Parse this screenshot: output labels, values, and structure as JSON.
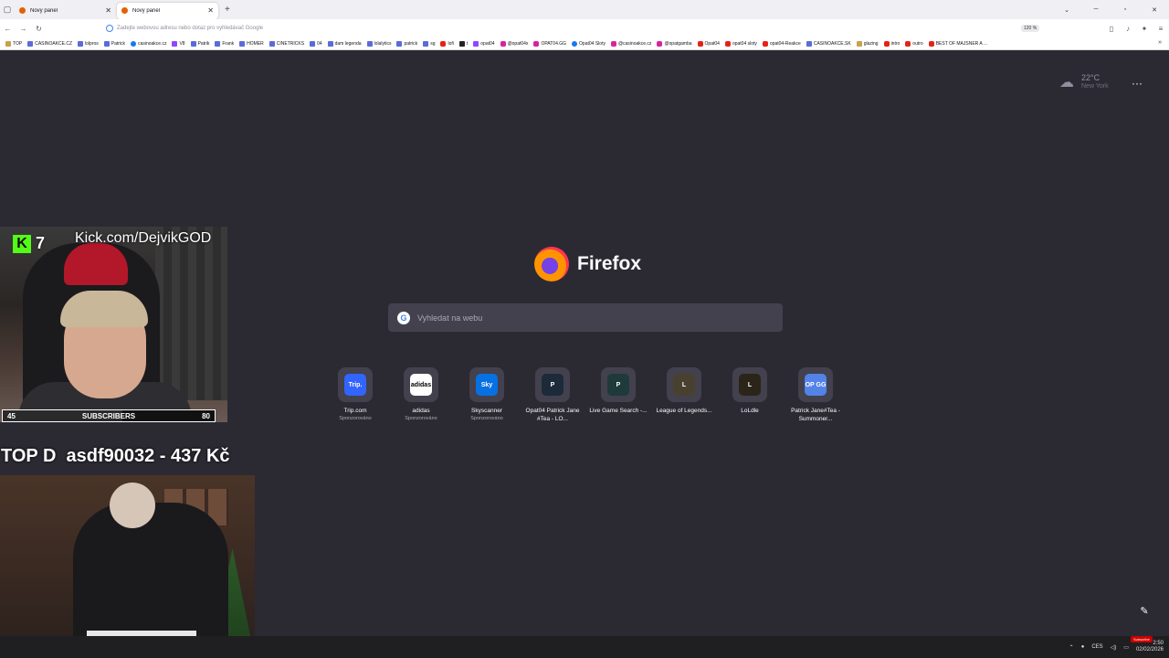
{
  "browser": {
    "tabs": [
      {
        "title": "Nový panel",
        "active": false
      },
      {
        "title": "Nový panel",
        "active": true
      }
    ],
    "new_tab_symbol": "+",
    "url_placeholder": "Zadejte webovou adresu nebo dotaz pro vyhledávač Google",
    "zoom": "120 %",
    "bookmarks": [
      {
        "label": "TOP",
        "icon": "folder-icon"
      },
      {
        "label": "CASINOAKCE.CZ",
        "icon": "site-icon"
      },
      {
        "label": "lolpros",
        "icon": "site-icon"
      },
      {
        "label": "Patrick",
        "icon": "site-icon"
      },
      {
        "label": "casinoakce.cz",
        "icon": "facebook-icon"
      },
      {
        "label": "V8",
        "icon": "twitch-icon"
      },
      {
        "label": "Patrik",
        "icon": "site-icon"
      },
      {
        "label": "Frank",
        "icon": "site-icon"
      },
      {
        "label": "HOMER",
        "icon": "site-icon"
      },
      {
        "label": "CINETRICKS",
        "icon": "site-icon"
      },
      {
        "label": "04",
        "icon": "site-icon"
      },
      {
        "label": "dam legenda",
        "icon": "site-icon"
      },
      {
        "label": "lolalytics",
        "icon": "site-icon"
      },
      {
        "label": "patrick",
        "icon": "site-icon"
      },
      {
        "label": "sg",
        "icon": "site-icon"
      },
      {
        "label": "lofi",
        "icon": "youtube-icon"
      },
      {
        "label": "t",
        "icon": "tiktok-icon"
      },
      {
        "label": "opat04",
        "icon": "twitch-icon"
      },
      {
        "label": "@opat04x",
        "icon": "instagram-icon"
      },
      {
        "label": "OPAT04.GG",
        "icon": "instagram-icon"
      },
      {
        "label": "Opat04 Sloty",
        "icon": "facebook-icon"
      },
      {
        "label": "@casinoakce.cz",
        "icon": "instagram-icon"
      },
      {
        "label": "@opatgamba",
        "icon": "instagram-icon"
      },
      {
        "label": "Opat04",
        "icon": "youtube-icon"
      },
      {
        "label": "opat04 sloty",
        "icon": "youtube-icon"
      },
      {
        "label": "opat04-Reakce",
        "icon": "youtube-icon"
      },
      {
        "label": "CASINOAKCE.SK",
        "icon": "site-icon"
      },
      {
        "label": "glazing",
        "icon": "folder-icon"
      },
      {
        "label": "intro",
        "icon": "youtube-icon"
      },
      {
        "label": "outro",
        "icon": "youtube-icon"
      },
      {
        "label": "BEST OF MAJSNER A ...",
        "icon": "youtube-icon"
      }
    ]
  },
  "newtab": {
    "weather": {
      "temp": "22°C",
      "city": "New York"
    },
    "logo_text": "Firefox",
    "search_placeholder": "Vyhledat na webu",
    "tiles": [
      {
        "label": "Trip.com",
        "sub": "Sponzorováno",
        "icon_text": "Trip.",
        "color": "#3264ff"
      },
      {
        "label": "adidas",
        "sub": "Sponzorováno",
        "icon_text": "adidas",
        "color": "#ffffff"
      },
      {
        "label": "Skyscanner",
        "sub": "Sponzorováno",
        "icon_text": "Sky",
        "color": "#0770e3"
      },
      {
        "label": "Opat04 Patrick Jane #Tea - LO...",
        "sub": "",
        "icon_text": "P",
        "color": "#1c2a3a"
      },
      {
        "label": "Live Game Search -...",
        "sub": "",
        "icon_text": "P",
        "color": "#1e3a3a"
      },
      {
        "label": "League of Legends...",
        "sub": "",
        "icon_text": "L",
        "color": "#4a4030"
      },
      {
        "label": "LoLdle",
        "sub": "",
        "icon_text": "L",
        "color": "#2b2418"
      },
      {
        "label": "Patrick Jane#Tea - Summoner...",
        "sub": "",
        "icon_text": "OP GG",
        "color": "#5383e8"
      }
    ]
  },
  "overlay": {
    "kick_count": "7",
    "kick_url": "Kick.com/DejvikGOD",
    "subs_current": "45",
    "subs_label": "SUBSCRIBERS",
    "subs_goal": "80",
    "subs_progress": 0.5625,
    "top_donation": "TOP D  asdf90032 - 437 Kč"
  },
  "taskbar": {
    "lang": "CES",
    "time": "2:50",
    "date": "02/02/2026",
    "subscribe": "Subscribe"
  }
}
